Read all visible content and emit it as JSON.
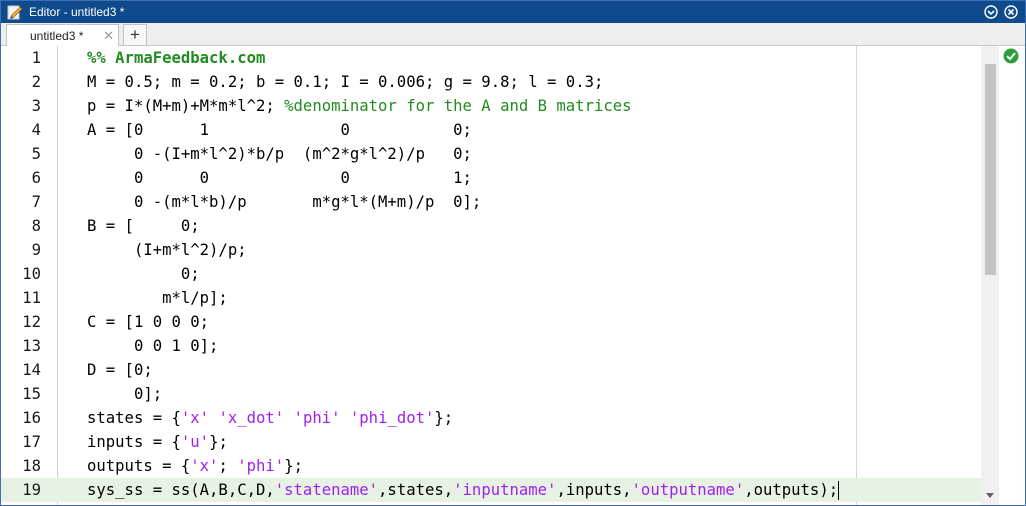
{
  "window": {
    "title": "Editor - untitled3 *"
  },
  "tabs": [
    {
      "label": "untitled3 *"
    }
  ],
  "icons": {
    "title": "editor-pen-icon",
    "menu": "chevron-down-circle-icon",
    "close": "close-circle-icon",
    "tab_close": "close-icon",
    "add_tab": "plus-icon",
    "status": "check-circle-icon"
  },
  "colors": {
    "titlebar": "#0f4a8c",
    "comment": "#228b22",
    "string": "#a020f0",
    "current_line": "#e8f2e4",
    "status_ok": "#2e9e3a"
  },
  "editor": {
    "lines": [
      {
        "no": "1",
        "tokens": [
          {
            "t": "%% ArmaFeedback.com",
            "c": "comment-bold"
          }
        ]
      },
      {
        "no": "2",
        "tokens": [
          {
            "t": "M = 0.5; m = 0.2; b = 0.1; I = 0.006; g = 9.8; l = 0.3;",
            "c": ""
          }
        ]
      },
      {
        "no": "3",
        "tokens": [
          {
            "t": "p = I*(M+m)+M*m*l^2; ",
            "c": ""
          },
          {
            "t": "%denominator for the A and B matrices",
            "c": "comment"
          }
        ]
      },
      {
        "no": "4",
        "tokens": [
          {
            "t": "A = [0      1              0           0;",
            "c": ""
          }
        ]
      },
      {
        "no": "5",
        "tokens": [
          {
            "t": "     0 -(I+m*l^2)*b/p  (m^2*g*l^2)/p   0;",
            "c": ""
          }
        ]
      },
      {
        "no": "6",
        "tokens": [
          {
            "t": "     0      0              0           1;",
            "c": ""
          }
        ]
      },
      {
        "no": "7",
        "tokens": [
          {
            "t": "     0 -(m*l*b)/p       m*g*l*(M+m)/p  0];",
            "c": ""
          }
        ]
      },
      {
        "no": "8",
        "tokens": [
          {
            "t": "B = [     0;",
            "c": ""
          }
        ]
      },
      {
        "no": "9",
        "tokens": [
          {
            "t": "     (I+m*l^2)/p;",
            "c": ""
          }
        ]
      },
      {
        "no": "10",
        "tokens": [
          {
            "t": "          0;",
            "c": ""
          }
        ]
      },
      {
        "no": "11",
        "tokens": [
          {
            "t": "        m*l/p];",
            "c": ""
          }
        ]
      },
      {
        "no": "12",
        "tokens": [
          {
            "t": "C = [1 0 0 0;",
            "c": ""
          }
        ]
      },
      {
        "no": "13",
        "tokens": [
          {
            "t": "     0 0 1 0];",
            "c": ""
          }
        ]
      },
      {
        "no": "14",
        "tokens": [
          {
            "t": "D = [0;",
            "c": ""
          }
        ]
      },
      {
        "no": "15",
        "tokens": [
          {
            "t": "     0];",
            "c": ""
          }
        ]
      },
      {
        "no": "16",
        "tokens": [
          {
            "t": "states = {",
            "c": ""
          },
          {
            "t": "'x'",
            "c": "string"
          },
          {
            "t": " ",
            "c": ""
          },
          {
            "t": "'x_dot'",
            "c": "string"
          },
          {
            "t": " ",
            "c": ""
          },
          {
            "t": "'phi'",
            "c": "string"
          },
          {
            "t": " ",
            "c": ""
          },
          {
            "t": "'phi_dot'",
            "c": "string"
          },
          {
            "t": "};",
            "c": ""
          }
        ]
      },
      {
        "no": "17",
        "tokens": [
          {
            "t": "inputs = {",
            "c": ""
          },
          {
            "t": "'u'",
            "c": "string"
          },
          {
            "t": "};",
            "c": ""
          }
        ]
      },
      {
        "no": "18",
        "tokens": [
          {
            "t": "outputs = {",
            "c": ""
          },
          {
            "t": "'x'",
            "c": "string"
          },
          {
            "t": "; ",
            "c": ""
          },
          {
            "t": "'phi'",
            "c": "string"
          },
          {
            "t": "};",
            "c": ""
          }
        ]
      },
      {
        "no": "19",
        "current": true,
        "tokens": [
          {
            "t": "sys_ss = ss(A,B,C,D,",
            "c": ""
          },
          {
            "t": "'statename'",
            "c": "string"
          },
          {
            "t": ",states,",
            "c": ""
          },
          {
            "t": "'inputname'",
            "c": "string"
          },
          {
            "t": ",inputs,",
            "c": ""
          },
          {
            "t": "'outputname'",
            "c": "string"
          },
          {
            "t": ",outputs);",
            "c": ""
          }
        ]
      }
    ]
  }
}
